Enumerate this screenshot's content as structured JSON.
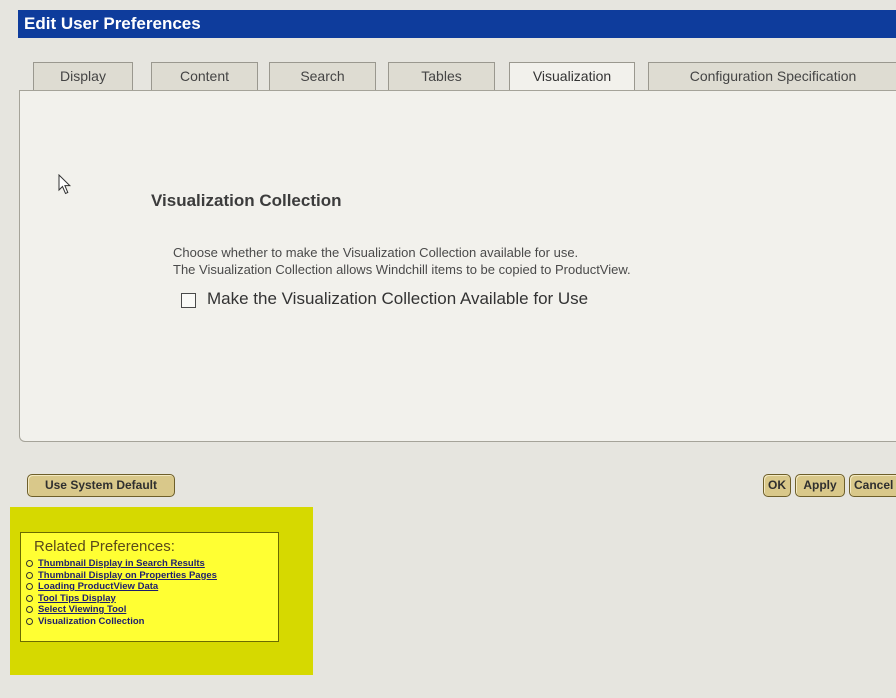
{
  "window": {
    "title": "Edit User Preferences"
  },
  "tabs": [
    {
      "label": "Display",
      "active": false
    },
    {
      "label": "Content",
      "active": false
    },
    {
      "label": "Search",
      "active": false
    },
    {
      "label": "Tables",
      "active": false
    },
    {
      "label": "Visualization",
      "active": true
    },
    {
      "label": "Configuration Specification",
      "active": false
    }
  ],
  "panel": {
    "section_title": "Visualization Collection",
    "description_line1": "Choose whether to make the Visualization Collection available for use.",
    "description_line2": "The Visualization Collection allows Windchill items to be copied to ProductView.",
    "checkbox_label": "Make the Visualization Collection Available for Use",
    "checkbox_checked": false
  },
  "buttons": {
    "use_system_default": "Use System Default",
    "ok": "OK",
    "apply": "Apply",
    "cancel": "Cancel"
  },
  "related": {
    "title": "Related Preferences:",
    "items": [
      {
        "label": "Thumbnail Display in Search Results",
        "link": true
      },
      {
        "label": "Thumbnail Display on Properties Pages",
        "link": true
      },
      {
        "label": "Loading ProductView Data",
        "link": true
      },
      {
        "label": "Tool Tips Display",
        "link": true
      },
      {
        "label": "Select Viewing Tool",
        "link": true
      },
      {
        "label": "Visualization Collection",
        "link": false
      }
    ]
  },
  "colors": {
    "titlebar": "#0e3c9c",
    "button": "#d9c88a",
    "highlight": "#d6d900",
    "related_box": "#ffff33"
  },
  "icons": {
    "cursor": "mouse-pointer-icon",
    "bullet": "circle-bullet-icon"
  }
}
